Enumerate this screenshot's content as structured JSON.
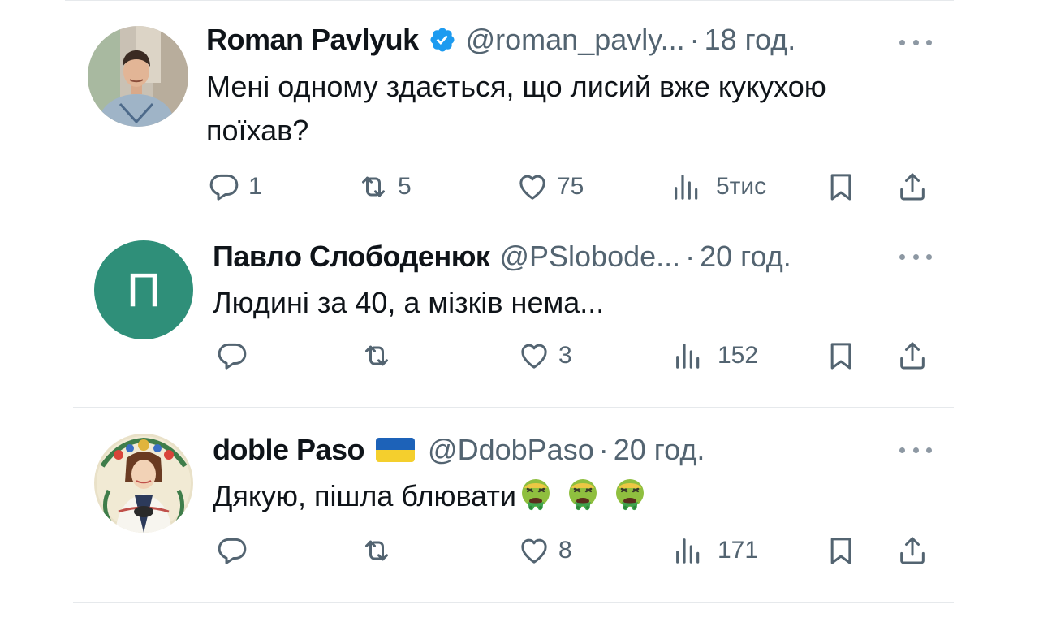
{
  "tweets": [
    {
      "name": "Roman Pavlyuk",
      "verified": true,
      "handle": "@roman_pavly...",
      "separator": "·",
      "time": "18 год.",
      "text": "Мені одному здається, що лисий вже кукухою поїхав?",
      "replies": "1",
      "retweets": "5",
      "likes": "75",
      "views": "5тис"
    },
    {
      "name": "Павло Слободенюк",
      "avatar_letter": "П",
      "handle": "@PSlobode...",
      "separator": "·",
      "time": "20 год.",
      "text": "Людині за 40, а мізків нема...",
      "replies": "",
      "retweets": "",
      "likes": "3",
      "views": "152"
    },
    {
      "name": "doble Paso",
      "flag": "ukraine-flag",
      "handle": "@DdobPaso",
      "separator": "·",
      "time": "20 год.",
      "text": "Дякую, пішла блювати",
      "emojis": [
        "face-vomiting-emoji",
        "face-vomiting-emoji",
        "face-vomiting-emoji"
      ],
      "replies": "",
      "retweets": "",
      "likes": "8",
      "views": "171"
    }
  ],
  "colors": {
    "text": "#0f1419",
    "secondary": "#536471",
    "verified": "#1d9bf0",
    "avatar_bg": "#2f8f79",
    "divider": "#e6e9ec"
  },
  "icons": [
    "reply-icon",
    "retweet-icon",
    "like-icon",
    "views-icon",
    "bookmark-icon",
    "share-icon",
    "more-icon",
    "verified-badge-icon"
  ]
}
